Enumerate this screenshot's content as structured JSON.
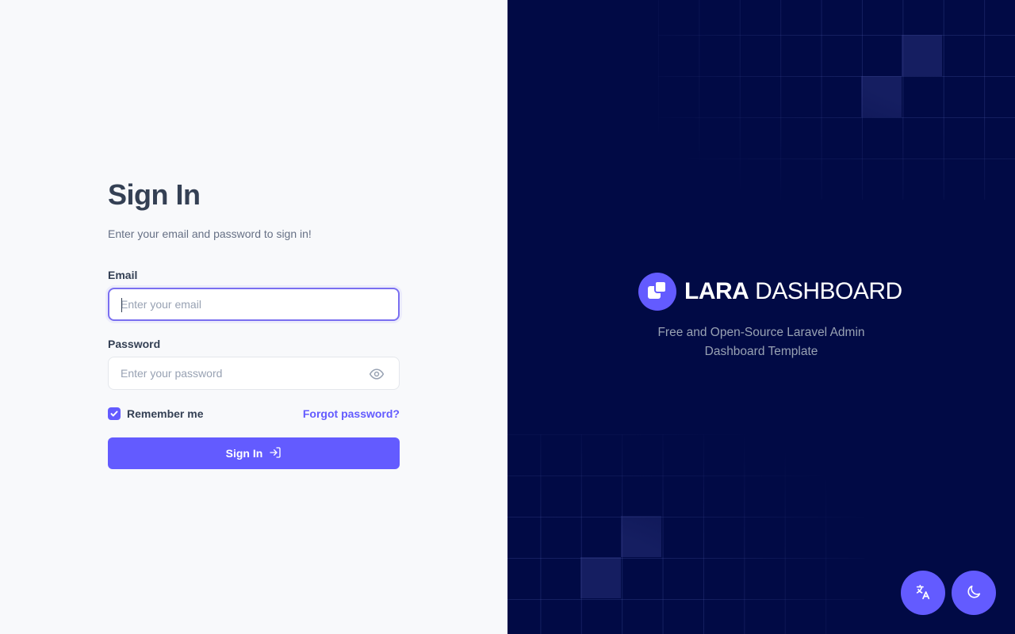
{
  "signin": {
    "title": "Sign In",
    "subtitle": "Enter your email and password to sign in!",
    "email": {
      "label": "Email",
      "placeholder": "Enter your email",
      "value": ""
    },
    "password": {
      "label": "Password",
      "placeholder": "Enter your password",
      "value": "",
      "toggle_icon": "eye-icon"
    },
    "remember": {
      "label": "Remember me",
      "checked": true
    },
    "forgot_label": "Forgot password?",
    "submit_label": "Sign In",
    "submit_icon": "sign-in-arrow-icon"
  },
  "brand": {
    "name_bold": "LARA",
    "name_light": "DASHBOARD",
    "tagline_line1": "Free and Open-Source Laravel Admin",
    "tagline_line2": "Dashboard Template"
  },
  "actions": {
    "language_icon": "translate-icon",
    "theme_icon": "moon-icon"
  },
  "colors": {
    "accent": "#635bff",
    "left_bg": "#f8f9fb",
    "right_bg": "#010a45",
    "heading": "#344054",
    "muted": "#667085"
  }
}
